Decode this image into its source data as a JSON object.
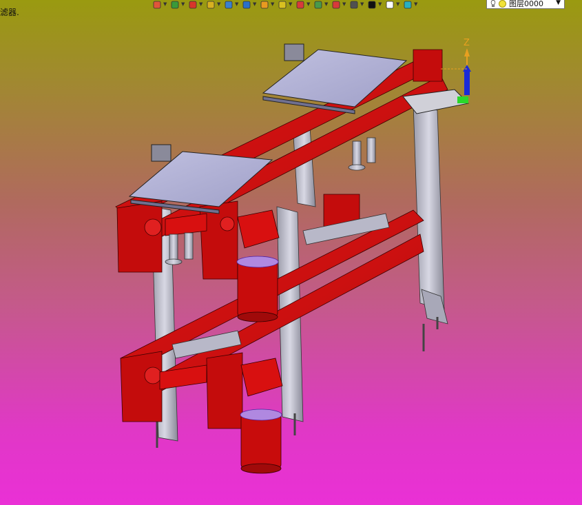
{
  "status": {
    "text": "滤器."
  },
  "toolbar": {
    "buttons": [
      {
        "name": "history-icon",
        "color": "#e0553a"
      },
      {
        "name": "filter-icon",
        "color": "#3a9a3a"
      },
      {
        "name": "sketch-pen-icon",
        "color": "#d8352a"
      },
      {
        "name": "solid-box-icon",
        "color": "#d8b020"
      },
      {
        "name": "shape-icon",
        "color": "#3a80d0"
      },
      {
        "name": "assembly-icon",
        "color": "#2a70c8"
      },
      {
        "name": "render-icon",
        "color": "#e89a20"
      },
      {
        "name": "inspect-icon",
        "color": "#d8c020"
      },
      {
        "name": "move-icon",
        "color": "#d83a3a"
      },
      {
        "name": "layout-icon",
        "color": "#4a9a4a"
      },
      {
        "name": "view-frame-icon",
        "color": "#d83a3a"
      },
      {
        "name": "monitor-icon",
        "color": "#505050"
      },
      {
        "name": "line-color-icon",
        "color": "#111111"
      },
      {
        "name": "fill-color-icon",
        "color": "#ffffff"
      },
      {
        "name": "layers-icon",
        "color": "#2ab0c0"
      }
    ]
  },
  "layer": {
    "label": "图层0000"
  },
  "colors": {
    "frame_red": "#d40c0c",
    "steel": "#b8b8c8",
    "plate": "#a8a8d0",
    "axis_z": "#e8a020"
  },
  "axis": {
    "z_label": "Z"
  }
}
